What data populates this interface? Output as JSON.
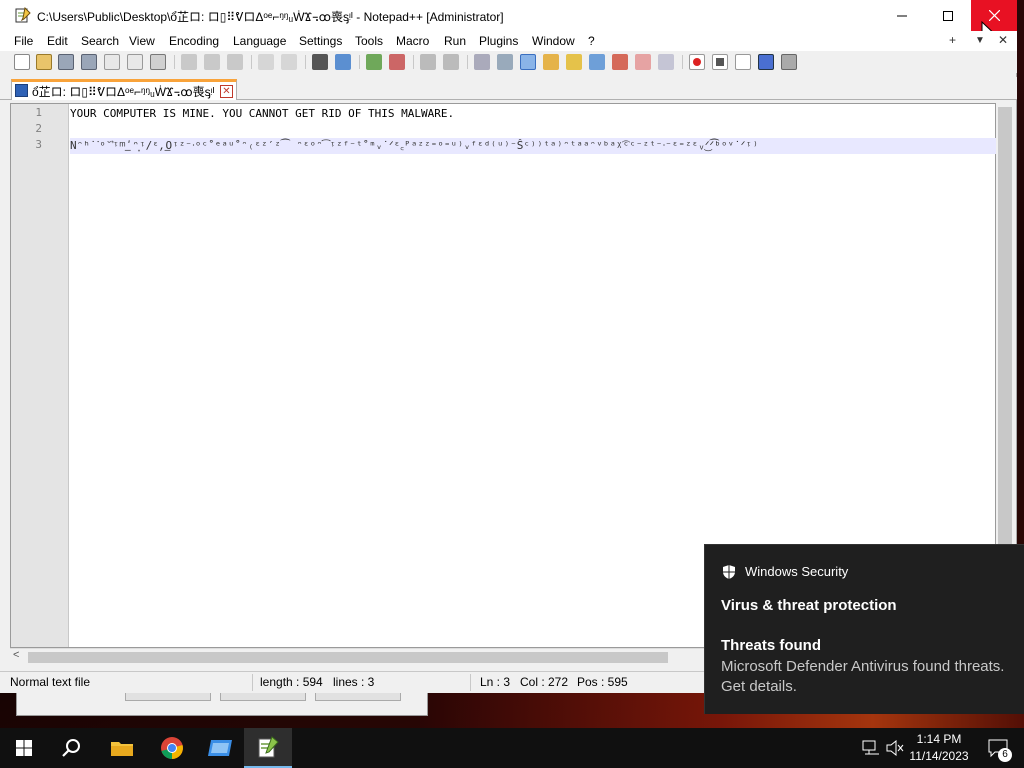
{
  "window": {
    "title": "C:\\Users\\Public\\Desktop\\ổ芷ロ: ロ▯⠿ᕓロΔᵒᵉ⌐ᵑᵑᵤẆϪ꓾ꝏ喪ᶊᵎᴵ - Notepad++ [Administrator]",
    "controls": {
      "minimize": "—",
      "maximize": "☐",
      "close": "✕"
    }
  },
  "menu": {
    "items": [
      "File",
      "Edit",
      "Search",
      "View",
      "Encoding",
      "Language",
      "Settings",
      "Tools",
      "Macro",
      "Run",
      "Plugins",
      "Window",
      "?"
    ],
    "right": {
      "add": "+",
      "dropdown": "▼",
      "close": "✕"
    }
  },
  "tab": {
    "label": "ổ芷ロ: ロ▯⠿ᕓロΔᵒᵉ⌐ᵑᵑᵤẆϪ꓾ꝏ喪ᶊᵎᴵ",
    "close": "✕"
  },
  "editor": {
    "lines": [
      {
        "num": "1",
        "text": "YOUR COMPUTER IS MINE. YOU CANNOT GET RID OF THIS MALWARE."
      },
      {
        "num": "2",
        "text": ""
      },
      {
        "num": "3",
        "text": "Nᵔʰ˙ᐝᵒ˘͛ᵎᵐ͟ʹᵔ͙ᵎ/ᵋ,͟Oᵎᶻ⁻ᐧᵒᶜ˚ᵉᵃᵘ˚ᵔ₍ᵋᶻ′ᶻ⁀ ᵔᵋᵒᵔ͡ᵎᶻᶠ⁻ᵗ˚ᵐᵥ˙ᐟᵋ꜀ᴾᵃᶻᶻ⁼ᵒ⁼ᵘ⁾ᵥᶠᵋᵈ⁽ᵘ⁾⁻Ŝᶜ⁾⁾ᵗᵃ⁾ᵔᵗᵃᵃᵔᵛᵇᵃᵡ͡ᶜᶜ⁻ᶻᵗ⁻ᐧ⁻ᵋ⁼ᶻᵋᵥ͜ᐟᐟ͡ᵇᵒᵛ˙ᐟᵎ⁾"
      }
    ]
  },
  "status": {
    "type": "Normal text file",
    "length": "length : 594",
    "lines": "lines : 3",
    "ln": "Ln : 3",
    "col": "Col : 272",
    "pos": "Pos : 595"
  },
  "toast": {
    "app": "Windows Security",
    "heading": "Virus & threat protection",
    "title": "Threats found",
    "body": "Microsoft Defender Antivirus found threats. Get details."
  },
  "taskbar": {
    "time": "1:14 PM",
    "date": "11/14/2023",
    "notification_count": "6"
  },
  "colors": {
    "close_button": "#e81123",
    "tab_accent": "#f9a33a",
    "current_line": "#e8e8ff",
    "toast_bg": "#1f1f1f"
  }
}
